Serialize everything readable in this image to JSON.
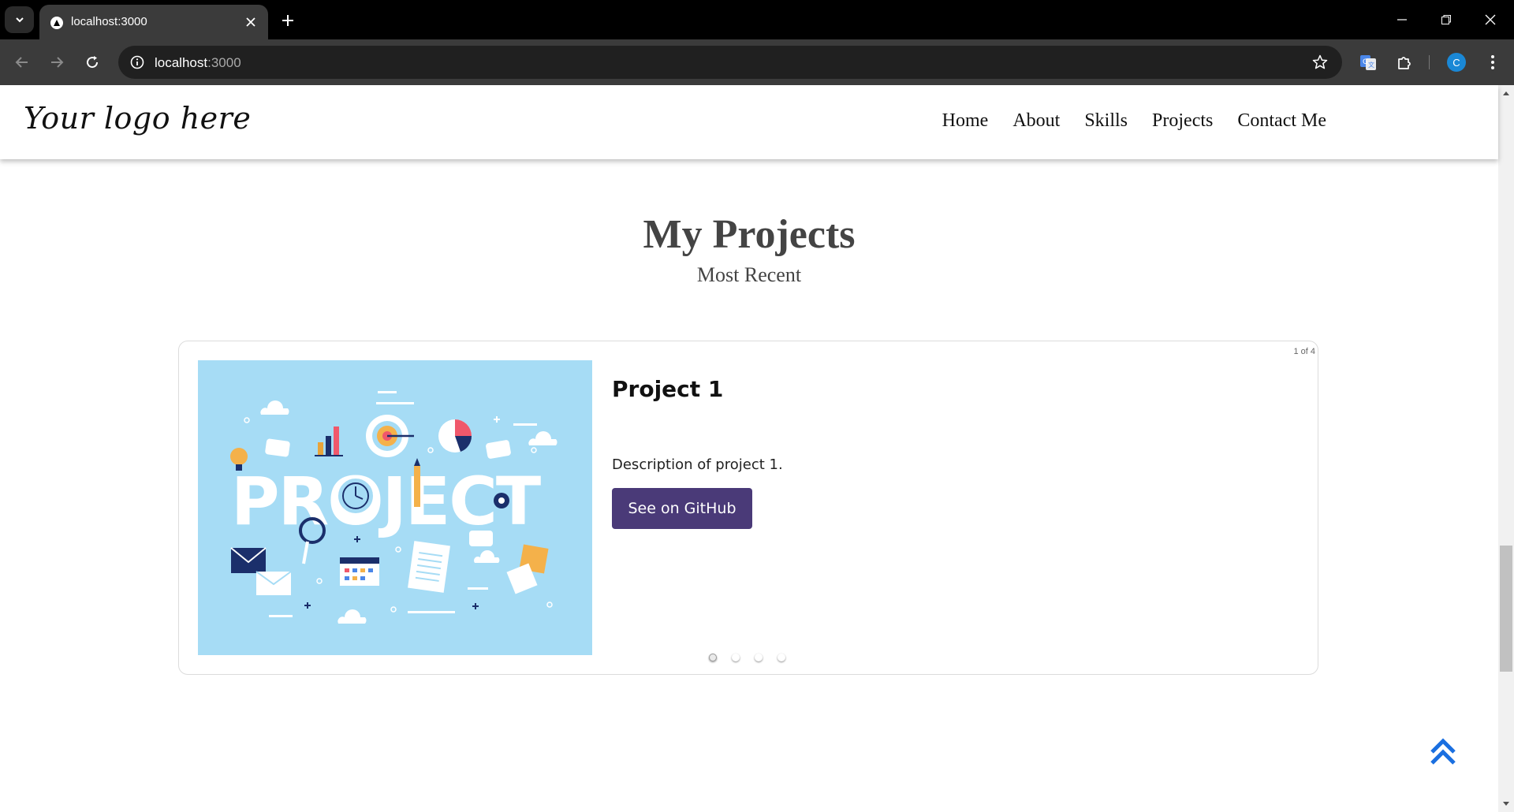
{
  "browser": {
    "tab_title": "localhost:3000",
    "url_host": "localhost",
    "url_port": ":3000",
    "profile_initial": "C",
    "icons": {
      "tab_menu": "chevron-down-icon",
      "favicon": "triangle-icon",
      "tab_close": "close-icon",
      "new_tab": "plus-icon",
      "back": "arrow-left-icon",
      "forward": "arrow-right-icon",
      "reload": "reload-icon",
      "site_info": "info-icon",
      "bookmark": "star-icon",
      "translate": "translate-icon",
      "extensions": "puzzle-icon",
      "menu": "kebab-menu-icon"
    }
  },
  "header": {
    "logo": "Your logo here",
    "nav": [
      "Home",
      "About",
      "Skills",
      "Projects",
      "Contact Me"
    ]
  },
  "projects": {
    "title": "My Projects",
    "subtitle": "Most Recent",
    "counter": "1 of 4",
    "current": {
      "title": "Project 1",
      "description": "Description of project 1.",
      "button_label": "See on GitHub",
      "image_word": "PROJECT"
    },
    "slide_count": 4,
    "active_index": 0
  },
  "colors": {
    "accent_button": "#4a3a78",
    "image_bg": "#a6dcf5",
    "back_to_top": "#1a6fe0"
  }
}
